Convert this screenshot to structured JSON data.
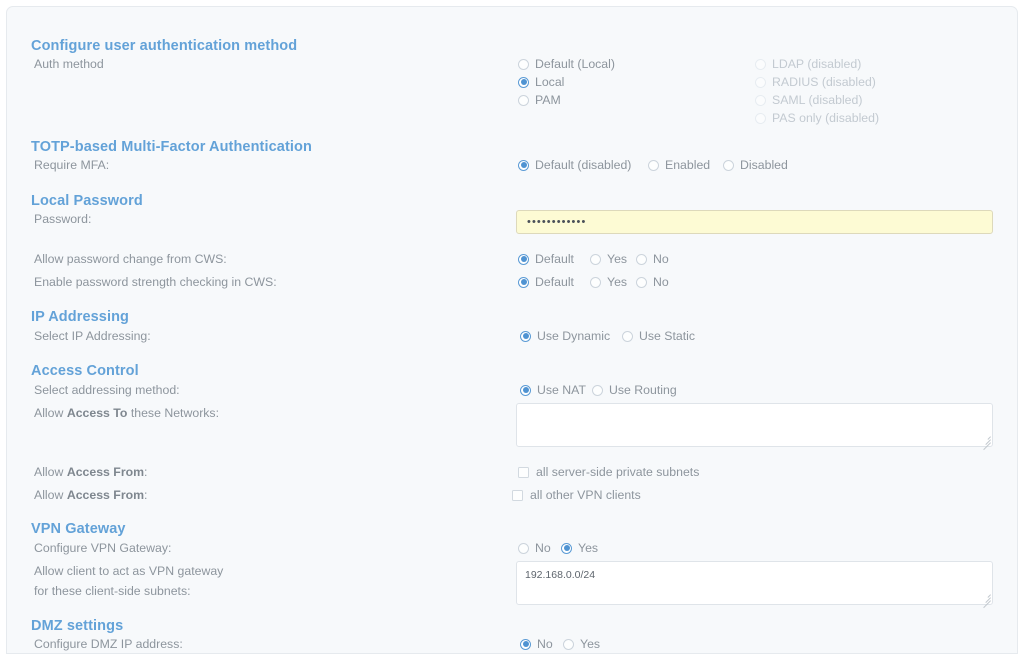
{
  "sections": {
    "auth": {
      "heading": "Configure user authentication method",
      "row_label": "Auth method",
      "options_left": [
        {
          "label": "Default (Local)",
          "selected": false,
          "disabled": false
        },
        {
          "label": "Local",
          "selected": true,
          "disabled": false
        },
        {
          "label": "PAM",
          "selected": false,
          "disabled": false
        }
      ],
      "options_right": [
        {
          "label": "LDAP (disabled)",
          "selected": false,
          "disabled": true
        },
        {
          "label": "RADIUS (disabled)",
          "selected": false,
          "disabled": true
        },
        {
          "label": "SAML (disabled)",
          "selected": false,
          "disabled": true
        },
        {
          "label": "PAS only (disabled)",
          "selected": false,
          "disabled": true
        }
      ]
    },
    "mfa": {
      "heading": "TOTP-based Multi-Factor Authentication",
      "row_label": "Require MFA:",
      "options": [
        {
          "label": "Default (disabled)",
          "selected": true
        },
        {
          "label": "Enabled",
          "selected": false
        },
        {
          "label": "Disabled",
          "selected": false
        }
      ]
    },
    "local_password": {
      "heading": "Local Password",
      "password_label": "Password:",
      "password_value": "************",
      "rows": [
        {
          "label": "Allow password change from CWS:",
          "options": [
            {
              "label": "Default",
              "selected": true
            },
            {
              "label": "Yes",
              "selected": false
            },
            {
              "label": "No",
              "selected": false
            }
          ]
        },
        {
          "label": "Enable password strength checking in CWS:",
          "options": [
            {
              "label": "Default",
              "selected": true
            },
            {
              "label": "Yes",
              "selected": false
            },
            {
              "label": "No",
              "selected": false
            }
          ]
        }
      ]
    },
    "ip_addressing": {
      "heading": "IP Addressing",
      "row_label": "Select IP Addressing:",
      "options": [
        {
          "label": "Use Dynamic",
          "selected": true
        },
        {
          "label": "Use Static",
          "selected": false
        }
      ]
    },
    "access_control": {
      "heading": "Access Control",
      "method_label": "Select addressing method:",
      "method_options": [
        {
          "label": "Use NAT",
          "selected": true
        },
        {
          "label": "Use Routing",
          "selected": false
        }
      ],
      "access_to_label_pre": "Allow ",
      "access_to_label_bold": "Access To",
      "access_to_label_post": " these Networks:",
      "access_to_value": "",
      "access_from_label_pre": "Allow ",
      "access_from_label_bold": "Access From",
      "access_from_label_post": ":",
      "checkboxes": [
        {
          "label": "all server-side private subnets",
          "checked": false
        },
        {
          "label": "all other VPN clients",
          "checked": false
        }
      ]
    },
    "vpn_gateway": {
      "heading": "VPN Gateway",
      "configure_label": "Configure VPN Gateway:",
      "configure_options": [
        {
          "label": "No",
          "selected": false
        },
        {
          "label": "Yes",
          "selected": true
        }
      ],
      "subnets_label_line1": "Allow client to act as VPN gateway",
      "subnets_label_line2": "for these client-side subnets:",
      "subnets_value": "192.168.0.0/24"
    },
    "dmz": {
      "heading": "DMZ settings",
      "row_label": "Configure DMZ IP address:",
      "options": [
        {
          "label": "No",
          "selected": true
        },
        {
          "label": "Yes",
          "selected": false
        }
      ]
    }
  },
  "colors": {
    "heading": "#63a2d8",
    "label": "#8d959d",
    "accent": "#4f93d2",
    "page_bg": "#f7f9fb",
    "autofill": "#fdfbd4"
  }
}
